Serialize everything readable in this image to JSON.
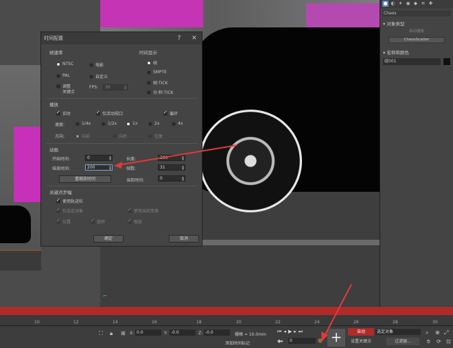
{
  "dialog": {
    "title": "时间配置",
    "help": "?",
    "close": "✕",
    "frame_rate": {
      "label": "帧速率",
      "options": [
        "NTSC",
        "电影",
        "PAL",
        "自定义"
      ],
      "adjust_keys": "调整\n关键点",
      "fps_label": "FPS:",
      "fps_value": "30"
    },
    "time_display": {
      "label": "时间显示",
      "options": [
        "帧",
        "SMPTE",
        "帧:TICK",
        "分:秒:TICK"
      ]
    },
    "playback": {
      "label": "播放",
      "realtime": "实时",
      "active_viewport": "仅活动视口",
      "loop": "循环",
      "speed_label": "速度:",
      "speeds": [
        "1/4x",
        "1/2x",
        "1x",
        "2x",
        "4x"
      ],
      "direction_label": "方向:",
      "directions": [
        "向前",
        "向后",
        "往复"
      ]
    },
    "animation": {
      "label": "动画",
      "start_label": "开始时间:",
      "start_value": "0",
      "end_label": "结束时间:",
      "end_value": "200",
      "length_label": "长度:",
      "length_value": "200",
      "frames_label": "帧数:",
      "frames_value": "31",
      "rescale_button": "重缩放时间",
      "current_label": "当前时间:",
      "current_value": "0"
    },
    "key_steps": {
      "label": "关键点步幅",
      "use_trackbar": "使用轨迹栏",
      "selected_only": "仅选定对象",
      "use_current": "使用当前变换",
      "position": "位置",
      "rotation": "旋转",
      "scale": "缩放"
    },
    "ok": "确定",
    "cancel": "取消"
  },
  "right_panel": {
    "dropdown": "Chaos",
    "object_type_label": "对象类型",
    "autogrid": "自动栅格",
    "chaos_scatter": "ChaosScatter",
    "name_color_label": "名称和颜色",
    "name_value": "组001"
  },
  "timeline": {
    "ticks": [
      "10",
      "12",
      "14",
      "16",
      "18",
      "20",
      "22",
      "24",
      "26",
      "28",
      "30"
    ]
  },
  "statusbar": {
    "x_label": "X:",
    "x_value": "0.0",
    "y_label": "Y:",
    "y_value": "-0.0",
    "z_label": "Z:",
    "z_value": "-0.0",
    "grid": "栅格 = 10.0mm",
    "add_time_tag": "添加时间标记",
    "auto": "自动",
    "selected_objects": "选定对象",
    "set_key": "设置关键点",
    "key_filters": "过滤器...",
    "frame_value": "0"
  },
  "colors": {
    "accent": "#b02a2a",
    "arrow": "#e23a3a"
  }
}
